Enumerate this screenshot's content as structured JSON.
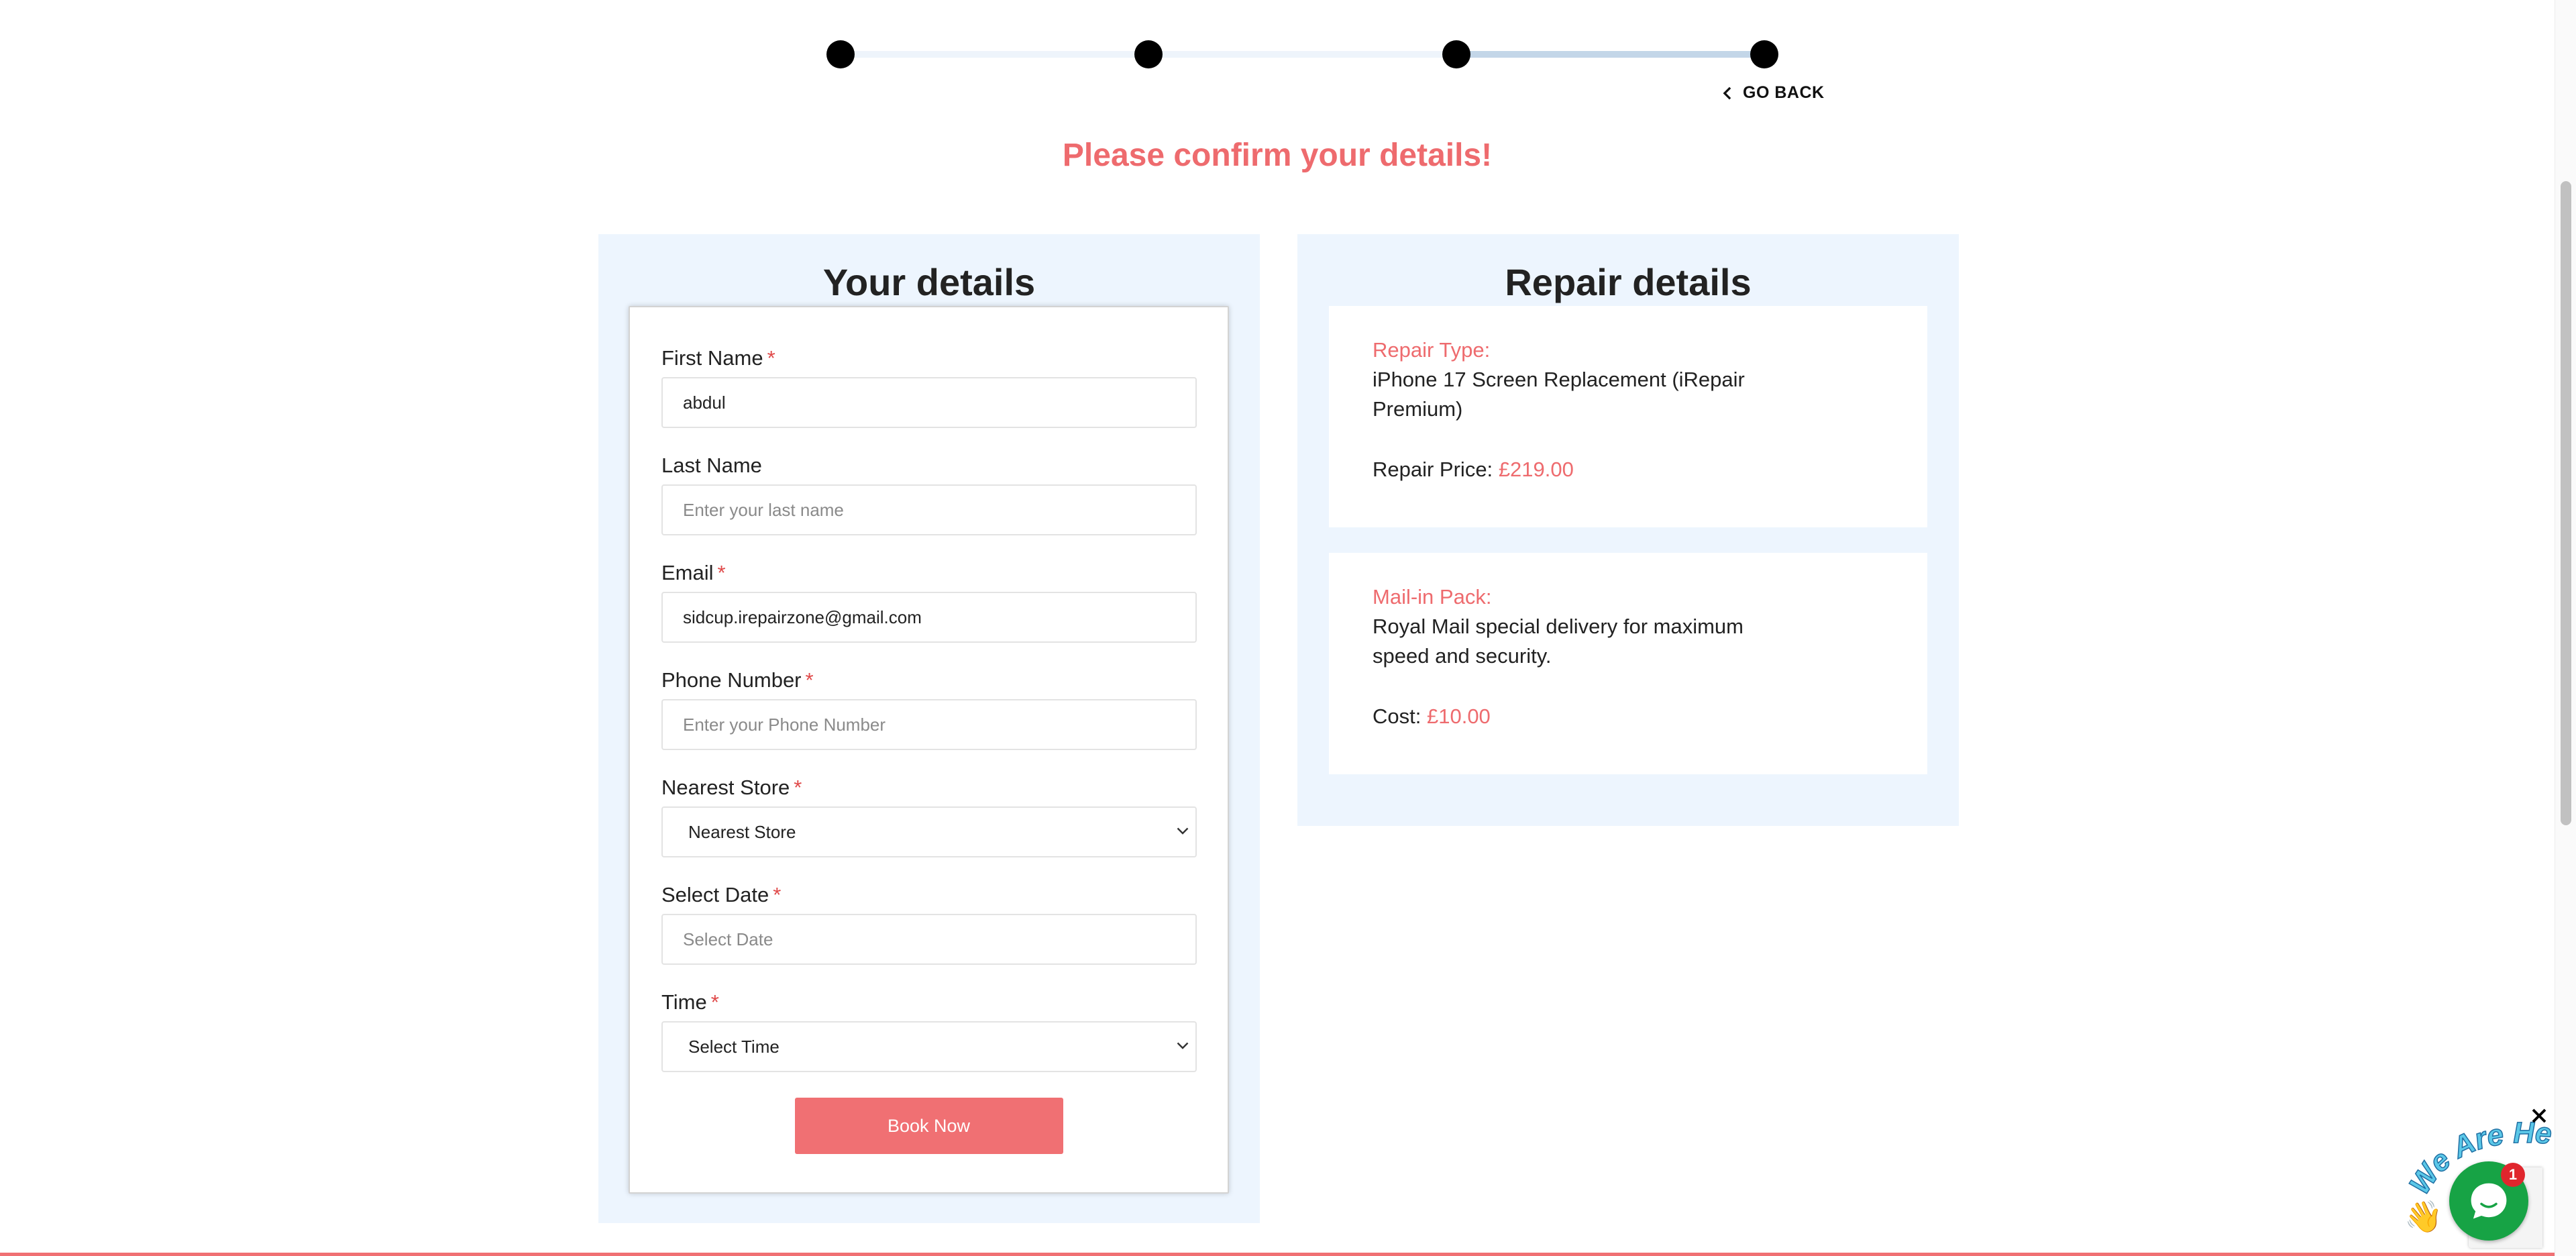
{
  "stepper": {
    "steps_total": 4,
    "current_step": 4
  },
  "nav": {
    "go_back_label": "GO BACK"
  },
  "page": {
    "title": "Please confirm your details!"
  },
  "your_details": {
    "heading": "Your details",
    "fields": {
      "first_name": {
        "label": "First Name",
        "required": "*",
        "value": "abdul",
        "placeholder": ""
      },
      "last_name": {
        "label": "Last Name",
        "value": "",
        "placeholder": "Enter your last name"
      },
      "email": {
        "label": "Email",
        "required": "*",
        "value": "sidcup.irepairzone@gmail.com",
        "placeholder": ""
      },
      "phone": {
        "label": "Phone Number",
        "required": "*",
        "value": "",
        "placeholder": "Enter your Phone Number"
      },
      "store": {
        "label": "Nearest Store",
        "required": "*",
        "selected": "Nearest Store"
      },
      "date": {
        "label": "Select Date",
        "required": "*",
        "value": "",
        "placeholder": "Select Date"
      },
      "time": {
        "label": "Time",
        "required": "*",
        "selected": "Select Time"
      }
    },
    "submit_label": "Book Now"
  },
  "repair_details": {
    "heading": "Repair details",
    "repair": {
      "label": "Repair Type:",
      "text": "iPhone 17 Screen Replacement (iRepair Premium)",
      "price_label": "Repair Price:",
      "price": "£219.00"
    },
    "mail_in": {
      "label": "Mail-in Pack:",
      "text": "Royal Mail special delivery for maximum speed and security.",
      "cost_label": "Cost:",
      "cost": "£10.00"
    }
  },
  "chat_widget": {
    "tagline": "We Are Here!",
    "unread_count": "1"
  },
  "colors": {
    "accent": "#ee6b6e",
    "panel_bg": "#edf5fe",
    "button_bg": "#f07073",
    "chat_green": "#17a345"
  }
}
